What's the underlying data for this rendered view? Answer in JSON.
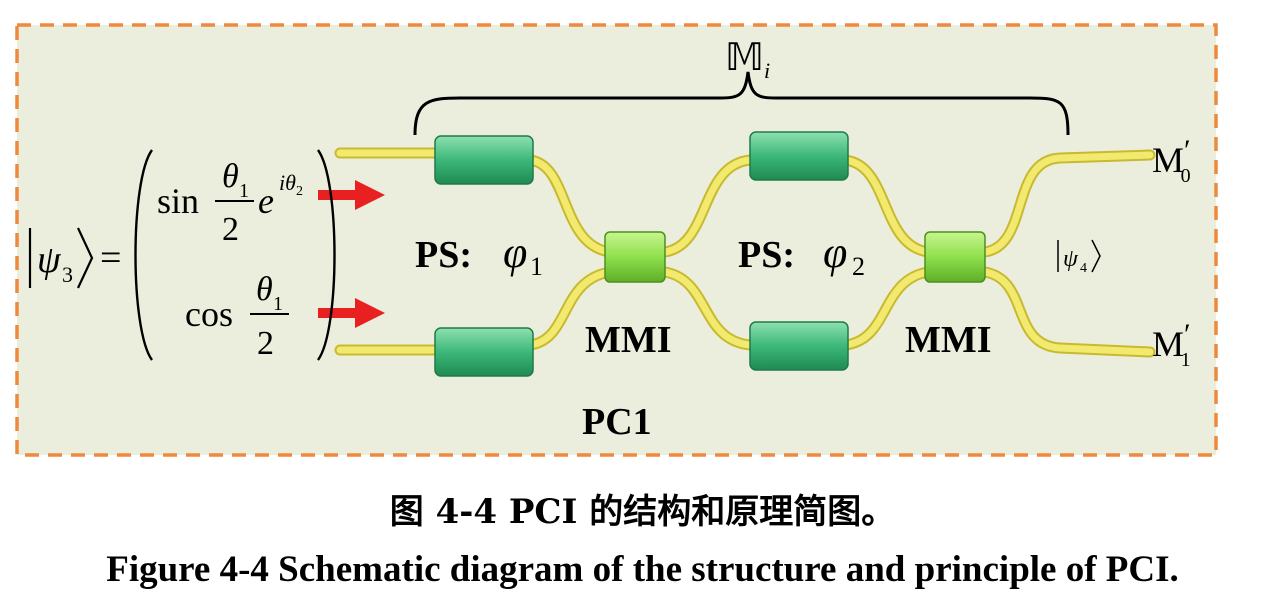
{
  "figure": {
    "bracket_label": "𝕄",
    "bracket_sub": "i",
    "input_state": {
      "ket": "ψ",
      "sub": "3",
      "equals": "=",
      "top_entry": {
        "func": "sin",
        "num": "θ",
        "num_sub": "1",
        "den": "2",
        "exp_base": "e",
        "exp_i": "i",
        "exp_theta": "θ",
        "exp_sub": "2"
      },
      "bottom_entry": {
        "func": "cos",
        "num": "θ",
        "num_sub": "1",
        "den": "2"
      }
    },
    "phase_shifter_1": {
      "prefix": "PS:",
      "symbol": "φ",
      "sub": "1"
    },
    "phase_shifter_2": {
      "prefix": "PS:",
      "symbol": "φ",
      "sub": "2"
    },
    "mmi_label_1": "MMI",
    "mmi_label_2": "MMI",
    "chip_label": "PC1",
    "output_state": {
      "ket": "ψ",
      "sub": "4"
    },
    "output_top": {
      "base": "M",
      "prime": "′",
      "sub": "0"
    },
    "output_bottom": {
      "base": "M",
      "prime": "′",
      "sub": "1"
    },
    "colors": {
      "background": "#eceedd",
      "frame": "#ef8a3d",
      "waveguide": "#f2ea6e",
      "waveguide_edge": "#c9b92f",
      "phase_shifter": "#3cb879",
      "mmi": "#8fe04d",
      "arrow": "#e82020"
    }
  },
  "caption_cn": "图 4-4 PCI 的结构和原理简图。",
  "caption_en": "Figure 4-4 Schematic diagram of the structure and principle of PCI."
}
